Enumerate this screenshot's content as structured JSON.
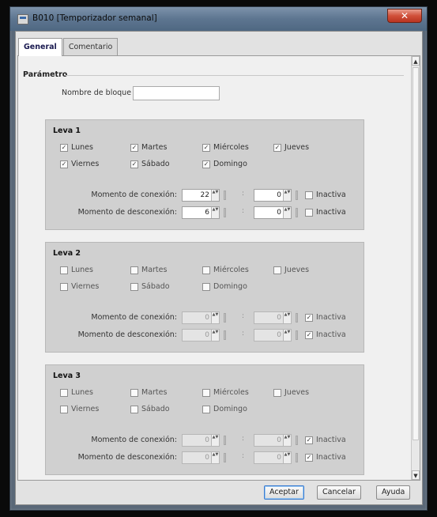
{
  "window": {
    "title": "B010 [Temporizador semanal]",
    "close_label": "✕"
  },
  "tabs": [
    {
      "label": "General",
      "active": true
    },
    {
      "label": "Comentario",
      "active": false
    }
  ],
  "parameters": {
    "section_title": "Parámetro",
    "block_name_label": "Nombre de bloque",
    "block_name_value": ""
  },
  "levas": [
    {
      "title": "Leva 1",
      "days": [
        {
          "label": "Lunes",
          "checked": true
        },
        {
          "label": "Martes",
          "checked": true
        },
        {
          "label": "Miércoles",
          "checked": true
        },
        {
          "label": "Jueves",
          "checked": true
        },
        {
          "label": "Viernes",
          "checked": true
        },
        {
          "label": "Sábado",
          "checked": true
        },
        {
          "label": "Domingo",
          "checked": true
        }
      ],
      "on_label": "Momento de conexión:",
      "off_label": "Momento de desconexión:",
      "on_hour": "22",
      "on_min": "0",
      "off_hour": "6",
      "off_min": "0",
      "on_inactive": false,
      "off_inactive": false,
      "inactive_label": "Inactiva"
    },
    {
      "title": "Leva 2",
      "days": [
        {
          "label": "Lunes",
          "checked": false
        },
        {
          "label": "Martes",
          "checked": false
        },
        {
          "label": "Miércoles",
          "checked": false
        },
        {
          "label": "Jueves",
          "checked": false
        },
        {
          "label": "Viernes",
          "checked": false
        },
        {
          "label": "Sábado",
          "checked": false
        },
        {
          "label": "Domingo",
          "checked": false
        }
      ],
      "on_label": "Momento de conexión:",
      "off_label": "Momento de desconexión:",
      "on_hour": "0",
      "on_min": "0",
      "off_hour": "0",
      "off_min": "0",
      "on_inactive": true,
      "off_inactive": true,
      "inactive_label": "Inactiva"
    },
    {
      "title": "Leva 3",
      "days": [
        {
          "label": "Lunes",
          "checked": false
        },
        {
          "label": "Martes",
          "checked": false
        },
        {
          "label": "Miércoles",
          "checked": false
        },
        {
          "label": "Jueves",
          "checked": false
        },
        {
          "label": "Viernes",
          "checked": false
        },
        {
          "label": "Sábado",
          "checked": false
        },
        {
          "label": "Domingo",
          "checked": false
        }
      ],
      "on_label": "Momento de conexión:",
      "off_label": "Momento de desconexión:",
      "on_hour": "0",
      "on_min": "0",
      "off_hour": "0",
      "off_min": "0",
      "on_inactive": true,
      "off_inactive": true,
      "inactive_label": "Inactiva"
    }
  ],
  "buttons": {
    "ok": "Aceptar",
    "cancel": "Cancelar",
    "help": "Ayuda"
  },
  "colors": {
    "title_gradient_top": "#7d93ab",
    "title_gradient_bottom": "#4f6882",
    "close_button": "#d0503a",
    "leva_background": "#d0d0d0",
    "panel_background": "#f0f0f0"
  },
  "icons": {
    "app": "timer-block-icon",
    "close": "close-icon",
    "scroll_up": "scroll-up-arrow-icon",
    "scroll_down": "scroll-down-arrow-icon",
    "checkbox_check": "checkmark-icon"
  }
}
